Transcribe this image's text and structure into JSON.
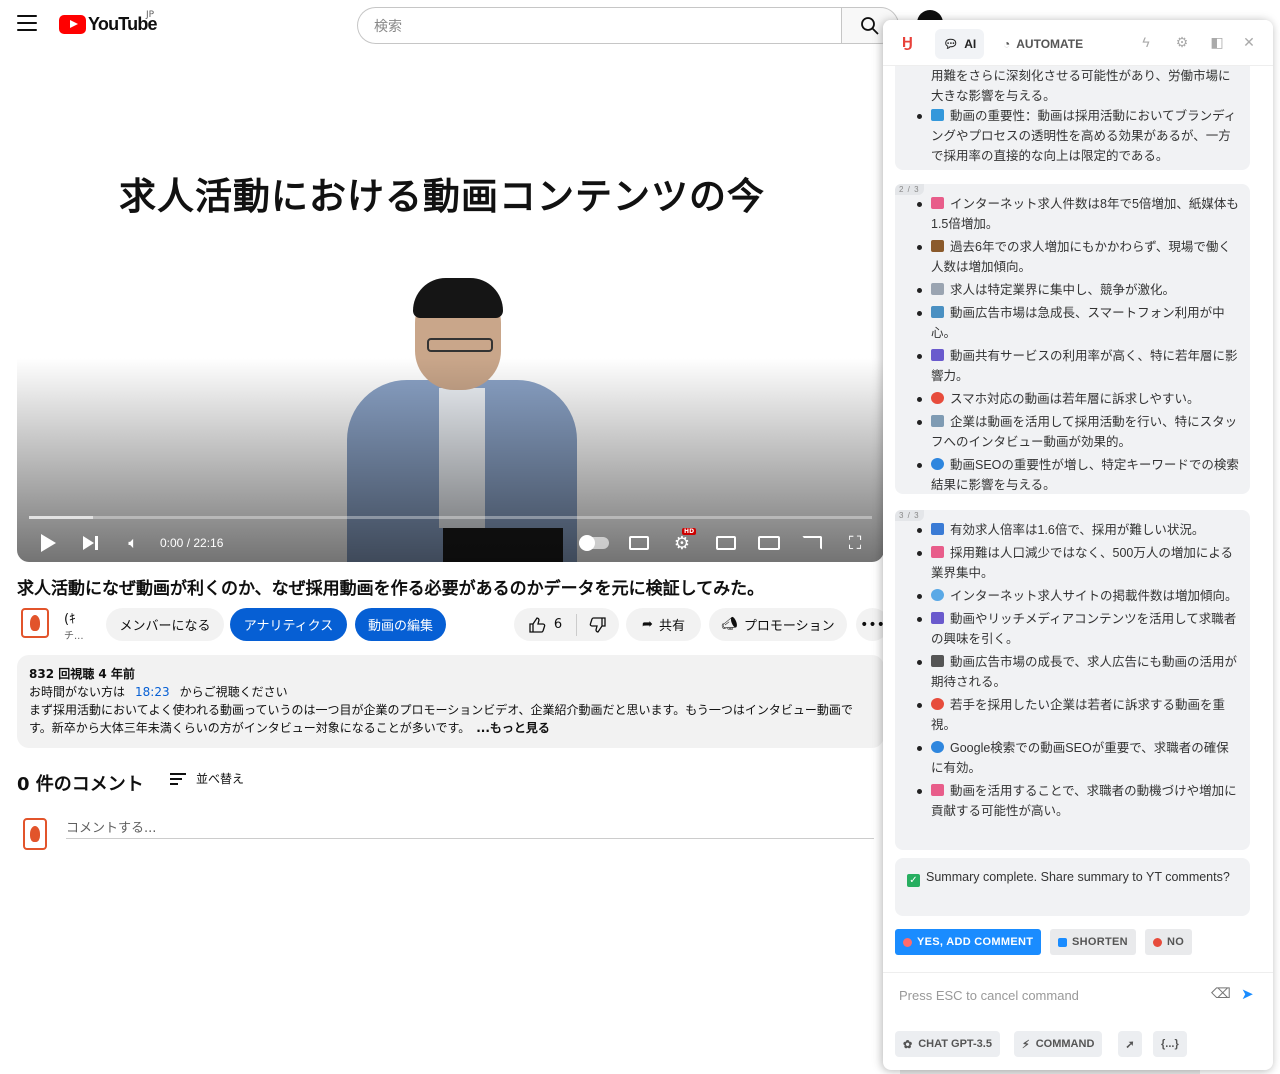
{
  "header": {
    "logo_text": "YouTube",
    "country": "JP",
    "search_placeholder": "検索"
  },
  "player": {
    "overlay_title": "求人活動における動画コンテンツの今",
    "time": "0:00 / 22:16",
    "progress_fraction": 0.0,
    "buffered_fraction": 0.076
  },
  "video": {
    "title": "求人活動になぜ動画が利くのか、なぜ採用動画を作る必要があるのかデータを元に検証してみた。",
    "channel_name": "(ｷ",
    "channel_sub": "チ..."
  },
  "actions": {
    "join": "メンバーになる",
    "analytics": "アナリティクス",
    "edit": "動画の編集",
    "likes": "6",
    "share": "共有",
    "promote": "プロモーション"
  },
  "description": {
    "meta": "832 回視聴  4 年前",
    "line1_prefix": "お時間がない方は",
    "timestamp": "18:23",
    "line1_suffix": "からご視聴ください",
    "body": "まず採用活動においてよく使われる動画っていうのは一つ目が企業のプロモーションビデオ、企業紹介動画だと思います。もう一つはインタビュー動画です。新卒から大体三年未満くらいの方がインタビュー対象になることが多いです。",
    "more": "...もっと見る"
  },
  "comments": {
    "title": "0 件のコメント",
    "sort": "並べ替え",
    "placeholder": "コメントする..."
  },
  "extension": {
    "tabs": [
      "AI",
      "AUTOMATE"
    ],
    "card1": {
      "cont": "用難をさらに深刻化させる可能性があり、労働市場に大きな影響を与える。",
      "items": [
        {
          "icon": "blue-square-icon",
          "color": "#3498db",
          "text": "動画の重要性：動画は採用活動においてブランディングやプロセスの透明性を高める効果があるが、一方で採用率の直接的な向上は限定的である。"
        }
      ]
    },
    "card2": {
      "badge": "2 / 3",
      "items": [
        {
          "icon": "chart-up-icon",
          "color": "#e85d8a",
          "text": "インターネット求人件数は8年で5倍増加、紙媒体も1.5倍増加。"
        },
        {
          "icon": "briefcase-icon",
          "color": "#8b5a2b",
          "text": "過去6年での求人増加にもかかわらず、現場で働く人数は増加傾向。"
        },
        {
          "icon": "newspaper-icon",
          "color": "#9aa4b1",
          "text": "求人は特定業界に集中し、競争が激化。"
        },
        {
          "icon": "screen-icon",
          "color": "#4a90c2",
          "text": "動画広告市場は急成長、スマートフォン利用が中心。"
        },
        {
          "icon": "people-icon",
          "color": "#6a5acd",
          "text": "動画共有サービスの利用率が高く、特に若年層に影響力。"
        },
        {
          "icon": "target-icon",
          "color": "#e74c3c",
          "text": "スマホ対応の動画は若年層に訴求しやすい。"
        },
        {
          "icon": "office-icon",
          "color": "#7f9bb3",
          "text": "企業は動画を活用して採用活動を行い、特にスタッフへのインタビュー動画が効果的。"
        },
        {
          "icon": "magnifier-icon",
          "color": "#2e86de",
          "text": "動画SEOの重要性が増し、特定キーワードでの検索結果に影響を与える。"
        }
      ]
    },
    "card3": {
      "badge": "3 / 3",
      "items": [
        {
          "icon": "bar-chart-icon",
          "color": "#3a7bd5",
          "text": "有効求人倍率は1.6倍で、採用が難しい状況。"
        },
        {
          "icon": "chart-up-icon",
          "color": "#e85d8a",
          "text": "採用難は人口減少ではなく、500万人の増加による業界集中。"
        },
        {
          "icon": "globe-icon",
          "color": "#5aa9e6",
          "text": "インターネット求人サイトの掲載件数は増加傾向。"
        },
        {
          "icon": "people-icon",
          "color": "#6a5acd",
          "text": "動画やリッチメディアコンテンツを活用して求職者の興味を引く。"
        },
        {
          "icon": "projector-icon",
          "color": "#555555",
          "text": "動画広告市場の成長で、求人広告にも動画の活用が期待される。"
        },
        {
          "icon": "target-icon",
          "color": "#e74c3c",
          "text": "若手を採用したい企業は若者に訴求する動画を重視。"
        },
        {
          "icon": "magnifier-icon",
          "color": "#2e86de",
          "text": "Google検索での動画SEOが重要で、求職者の確保に有効。"
        },
        {
          "icon": "chart-up-icon",
          "color": "#e85d8a",
          "text": "動画を活用することで、求職者の動機づけや増加に貢献する可能性が高い。"
        }
      ]
    },
    "status": "Summary complete. Share summary to YT comments?",
    "buttons": {
      "yes": "YES, ADD COMMENT",
      "shorten": "SHORTEN",
      "no": "NO"
    },
    "input_placeholder": "Press ESC to cancel command",
    "footer": {
      "model": "CHAT GPT-3.5",
      "command": "COMMAND",
      "braces": "{...}"
    },
    "colors": {
      "accent": "#1a8cff",
      "brand": "#e8413a",
      "yt_blue": "#065fd4"
    }
  }
}
